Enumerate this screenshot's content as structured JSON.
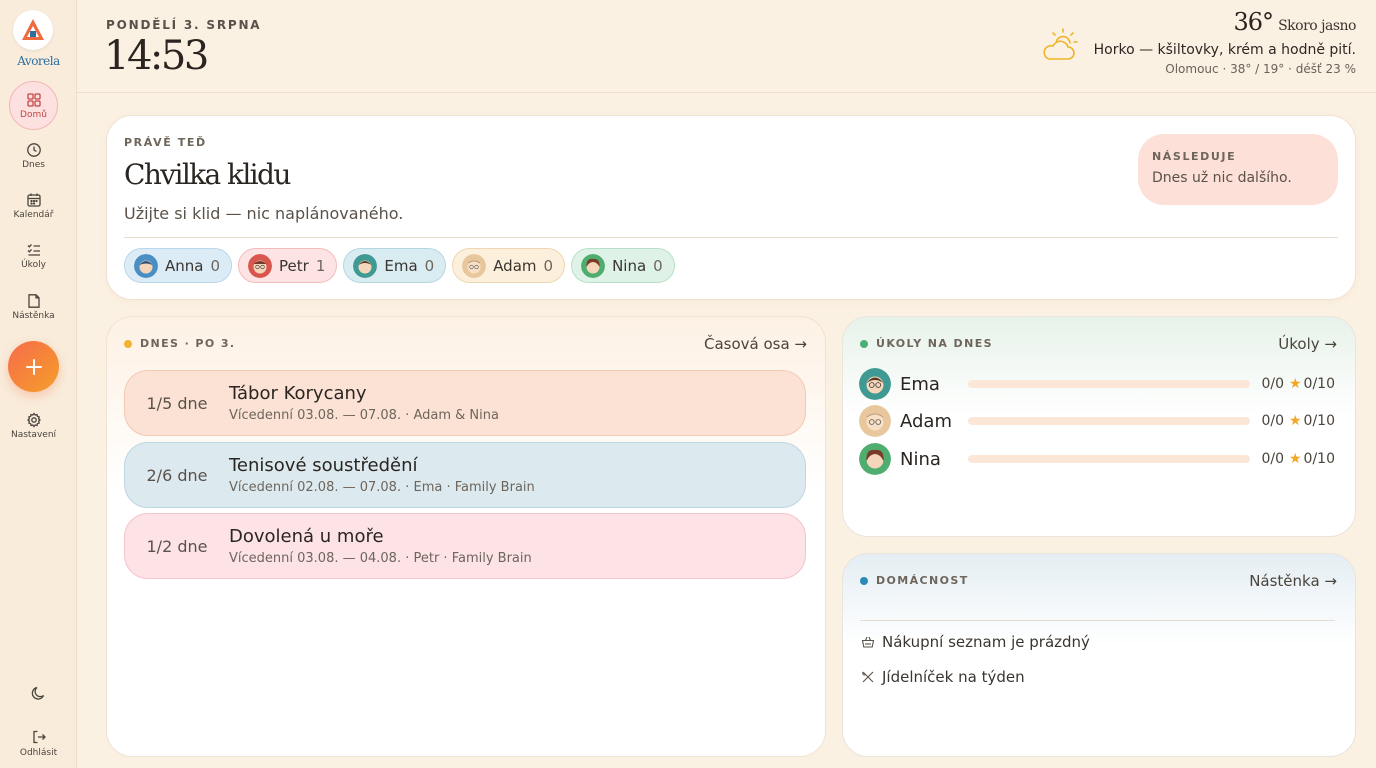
{
  "app": {
    "name": "Avorela"
  },
  "sidebar": {
    "items": [
      {
        "label": "Domů",
        "icon": "grid-icon",
        "active": true
      },
      {
        "label": "Dnes",
        "icon": "clock-icon"
      },
      {
        "label": "Kalendář",
        "icon": "calendar-icon"
      },
      {
        "label": "Úkoly",
        "icon": "checklist-icon"
      },
      {
        "label": "Nástěnka",
        "icon": "note-icon"
      },
      {
        "label": "Nastavení",
        "icon": "gear-icon"
      }
    ],
    "logout_label": "Odhlásit"
  },
  "header": {
    "date": "PONDĚLÍ 3. SRPNA",
    "time": "14:53",
    "weather": {
      "temp": "36°",
      "condition": "Skoro jasno",
      "advice": "Horko — kšiltovky, krém a hodně pití.",
      "detail": "Olomouc · 38° / 19° · déšť 23 %"
    }
  },
  "now": {
    "eyebrow": "PRÁVĚ TEĎ",
    "title": "Chvilka klidu",
    "subtitle": "Užijte si klid — nic naplánovaného.",
    "next_label": "NÁSLEDUJE",
    "next_value": "Dnes už nic dalšího.",
    "members": [
      {
        "name": "Anna",
        "count": "0",
        "bg": "#dcecf6",
        "border": "#b9d6ea",
        "avatar": "#4a8fc4"
      },
      {
        "name": "Petr",
        "count": "1",
        "bg": "#fde3e3",
        "border": "#f3bcbc",
        "avatar": "#d9564e"
      },
      {
        "name": "Ema",
        "count": "0",
        "bg": "#d9ecf1",
        "border": "#b6d7e0",
        "avatar": "#3f9a94"
      },
      {
        "name": "Adam",
        "count": "0",
        "bg": "#fcefdc",
        "border": "#efd6b2",
        "avatar": "#e8c79c"
      },
      {
        "name": "Nina",
        "count": "0",
        "bg": "#dff2e8",
        "border": "#b8e0c9",
        "avatar": "#4fae6f"
      }
    ]
  },
  "today": {
    "label": "DNES · PO 3.",
    "link": "Časová osa →",
    "dot_color": "#f2b233",
    "events": [
      {
        "progress": "1/5 dne",
        "title": "Tábor Korycany",
        "meta": "Vícedenní 03.08. — 07.08. · Adam & Nina",
        "bg": "#fbe2d4",
        "border": "#f3c9b2"
      },
      {
        "progress": "2/6 dne",
        "title": "Tenisové soustředění",
        "meta": "Vícedenní 02.08. — 07.08. · Ema · Family Brain",
        "bg": "#dceaf0",
        "border": "#bdd6e2"
      },
      {
        "progress": "1/2 dne",
        "title": "Dovolená u moře",
        "meta": "Vícedenní 03.08. — 04.08. · Petr · Family Brain",
        "bg": "#fde3e6",
        "border": "#f4c3cb"
      }
    ]
  },
  "tasks": {
    "label": "ÚKOLY NA DNES",
    "link": "Úkoly →",
    "dot_color": "#4caf78",
    "rows": [
      {
        "name": "Ema",
        "count": "0/0",
        "points": "0/10",
        "progress": 0,
        "avatar": "#3f9a94"
      },
      {
        "name": "Adam",
        "count": "0/0",
        "points": "0/10",
        "progress": 0,
        "avatar": "#e8c79c"
      },
      {
        "name": "Nina",
        "count": "0/0",
        "points": "0/10",
        "progress": 0,
        "avatar": "#4fae6f"
      }
    ]
  },
  "household": {
    "label": "DOMÁCNOST",
    "link": "Nástěnka →",
    "dot_color": "#2d88b8",
    "items": [
      {
        "label": "Nákupní seznam je prázdný",
        "icon": "basket-icon"
      },
      {
        "label": "Jídelníček na týden",
        "icon": "utensils-icon"
      }
    ]
  }
}
